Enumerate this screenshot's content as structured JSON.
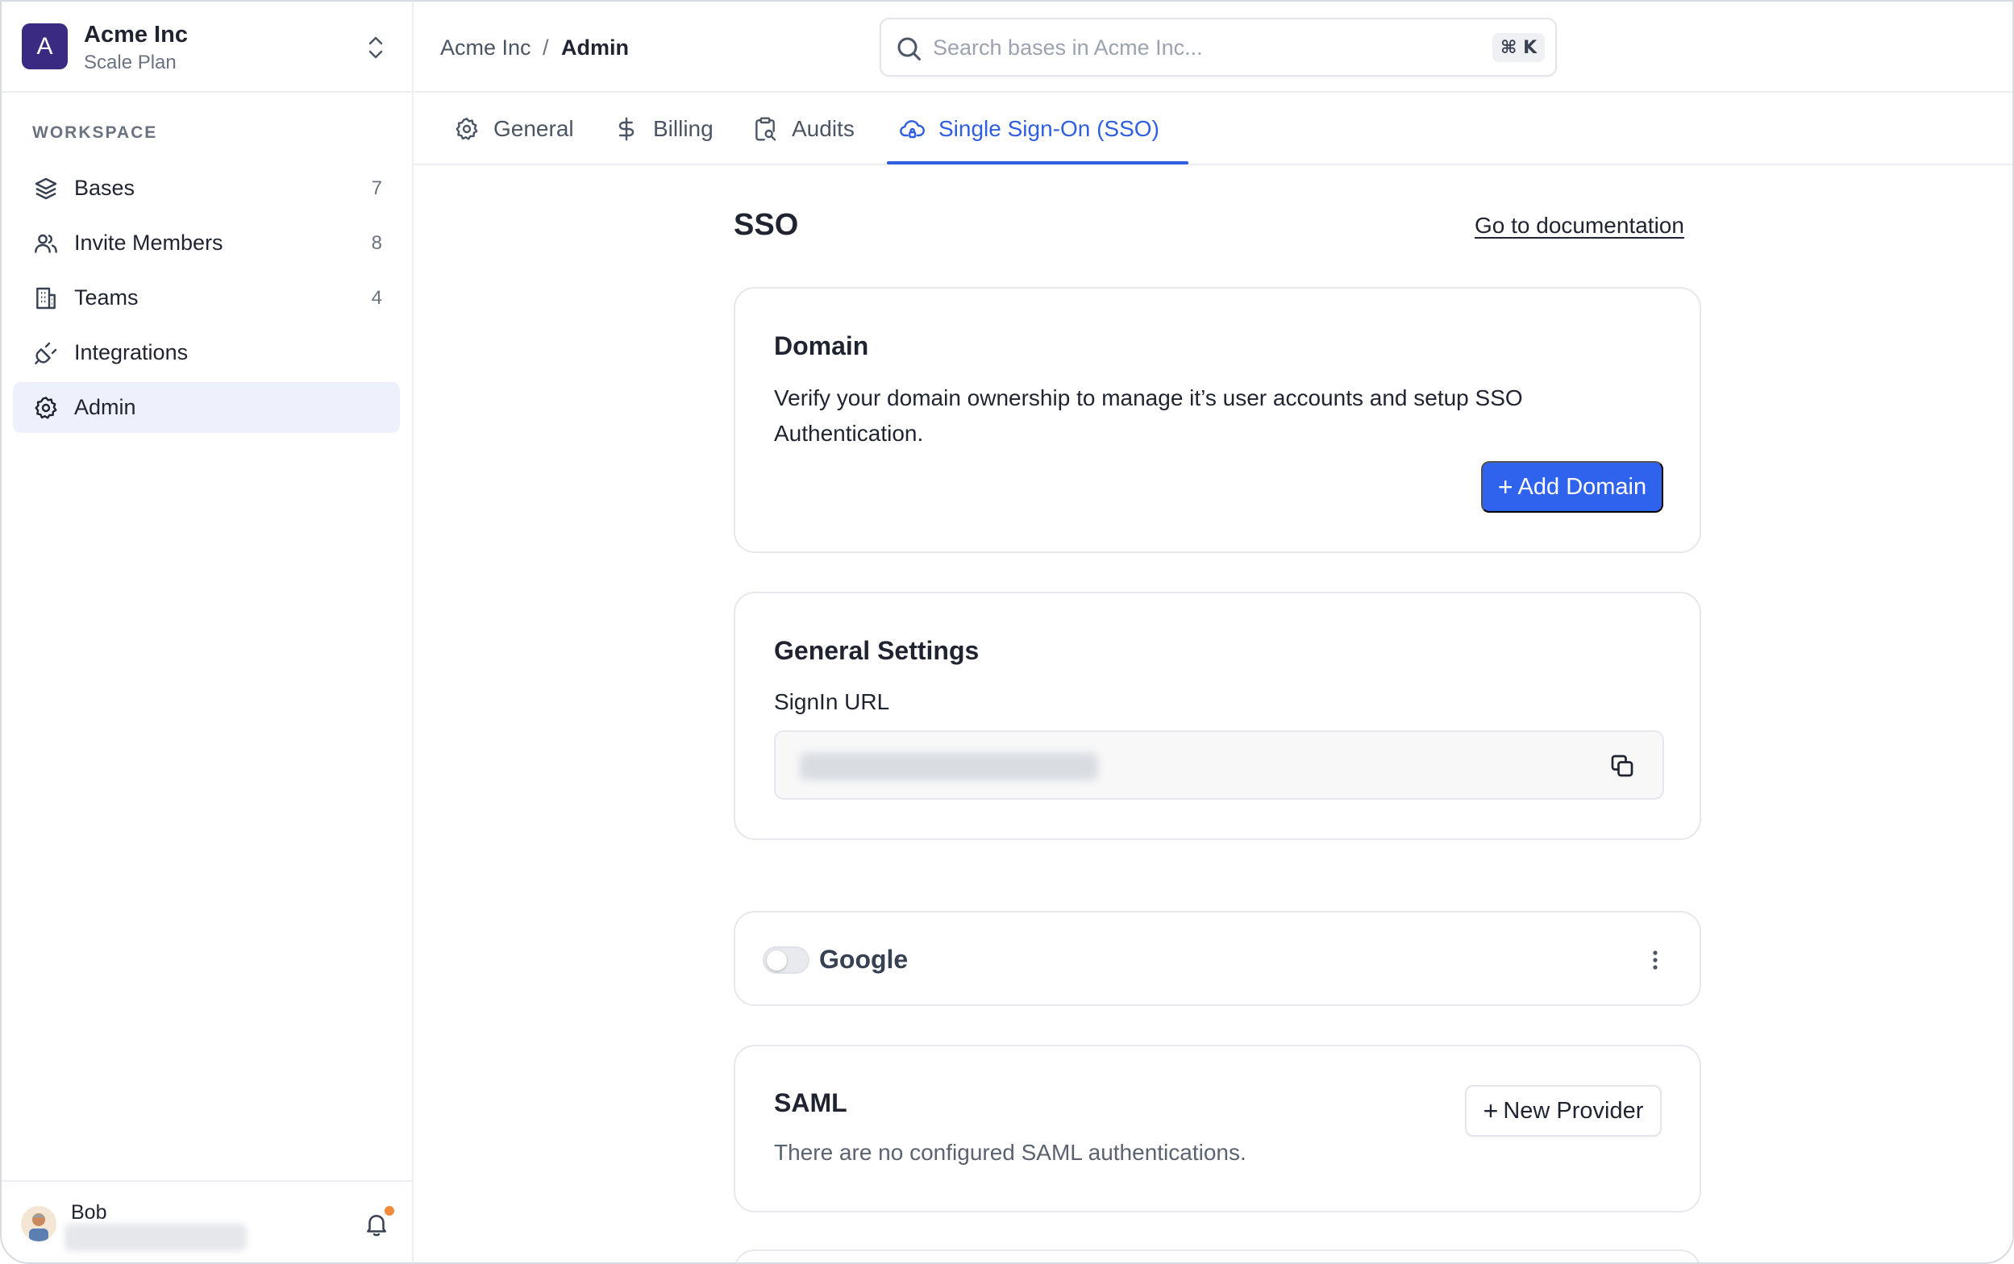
{
  "workspace": {
    "avatar_letter": "A",
    "name": "Acme Inc",
    "plan": "Scale Plan"
  },
  "sidebar": {
    "section_label": "WORKSPACE",
    "items": [
      {
        "label": "Bases",
        "count": "7",
        "icon": "layers-icon"
      },
      {
        "label": "Invite Members",
        "count": "8",
        "icon": "users-icon"
      },
      {
        "label": "Teams",
        "count": "4",
        "icon": "building-icon"
      },
      {
        "label": "Integrations",
        "count": "",
        "icon": "plug-icon"
      },
      {
        "label": "Admin",
        "count": "",
        "icon": "gear-icon",
        "active": true
      }
    ]
  },
  "user": {
    "name": "Bob"
  },
  "breadcrumb": {
    "root": "Acme Inc",
    "separator": "/",
    "current": "Admin"
  },
  "search": {
    "placeholder": "Search bases in Acme Inc...",
    "shortcut": "⌘ K"
  },
  "tabs": [
    {
      "label": "General",
      "icon": "gear-icon"
    },
    {
      "label": "Billing",
      "icon": "dollar-icon"
    },
    {
      "label": "Audits",
      "icon": "clipboard-search-icon"
    },
    {
      "label": "Single Sign-On (SSO)",
      "icon": "cloud-lock-icon",
      "active": true
    }
  ],
  "main": {
    "title": "SSO",
    "doc_link": "Go to documentation"
  },
  "domain_card": {
    "title": "Domain",
    "description": "Verify your domain ownership to manage it’s user accounts and setup SSO Authentication.",
    "button_label": "Add Domain"
  },
  "general_settings": {
    "title": "General Settings",
    "signin_label": "SignIn URL"
  },
  "google_card": {
    "label": "Google",
    "enabled": false
  },
  "saml_card": {
    "title": "SAML",
    "empty_text": "There are no configured SAML authentications.",
    "button_label": "New Provider"
  },
  "colors": {
    "accent": "#2f5fe0",
    "primary_button": "#2f63ee",
    "workspace_avatar": "#3b2a82",
    "notification_dot": "#f08a3c"
  }
}
